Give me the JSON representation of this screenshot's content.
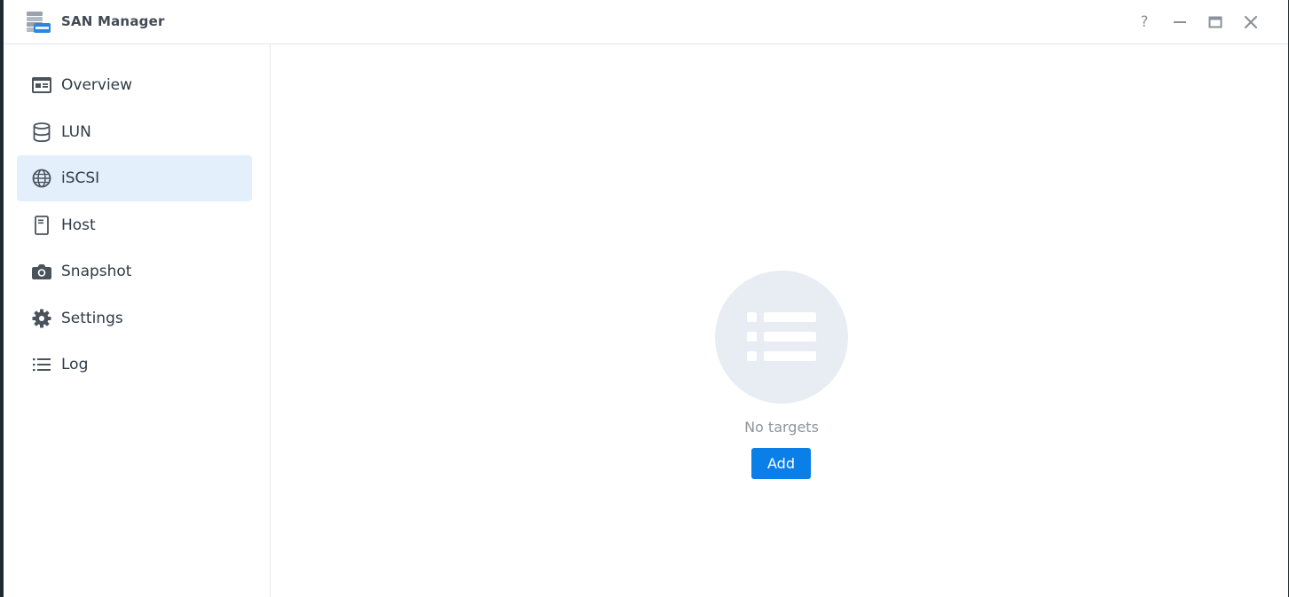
{
  "window": {
    "title": "SAN Manager",
    "controls": {
      "help_label": "?"
    }
  },
  "sidebar": {
    "items": [
      {
        "label": "Overview",
        "icon": "overview-card-icon",
        "active": false
      },
      {
        "label": "LUN",
        "icon": "database-icon",
        "active": false
      },
      {
        "label": "iSCSI",
        "icon": "globe-icon",
        "active": true
      },
      {
        "label": "Host",
        "icon": "server-host-icon",
        "active": false
      },
      {
        "label": "Snapshot",
        "icon": "camera-icon",
        "active": false
      },
      {
        "label": "Settings",
        "icon": "gear-icon",
        "active": false
      },
      {
        "label": "Log",
        "icon": "list-icon",
        "active": false
      }
    ]
  },
  "main": {
    "empty_state": {
      "icon": "list-icon",
      "message": "No targets",
      "add_label": "Add"
    }
  },
  "colors": {
    "accent": "#0a7fe8",
    "active_item_bg": "#e3f0fc",
    "empty_circle": "#e8edf3",
    "text": "#2f3a45",
    "muted_text": "#8e969e"
  }
}
